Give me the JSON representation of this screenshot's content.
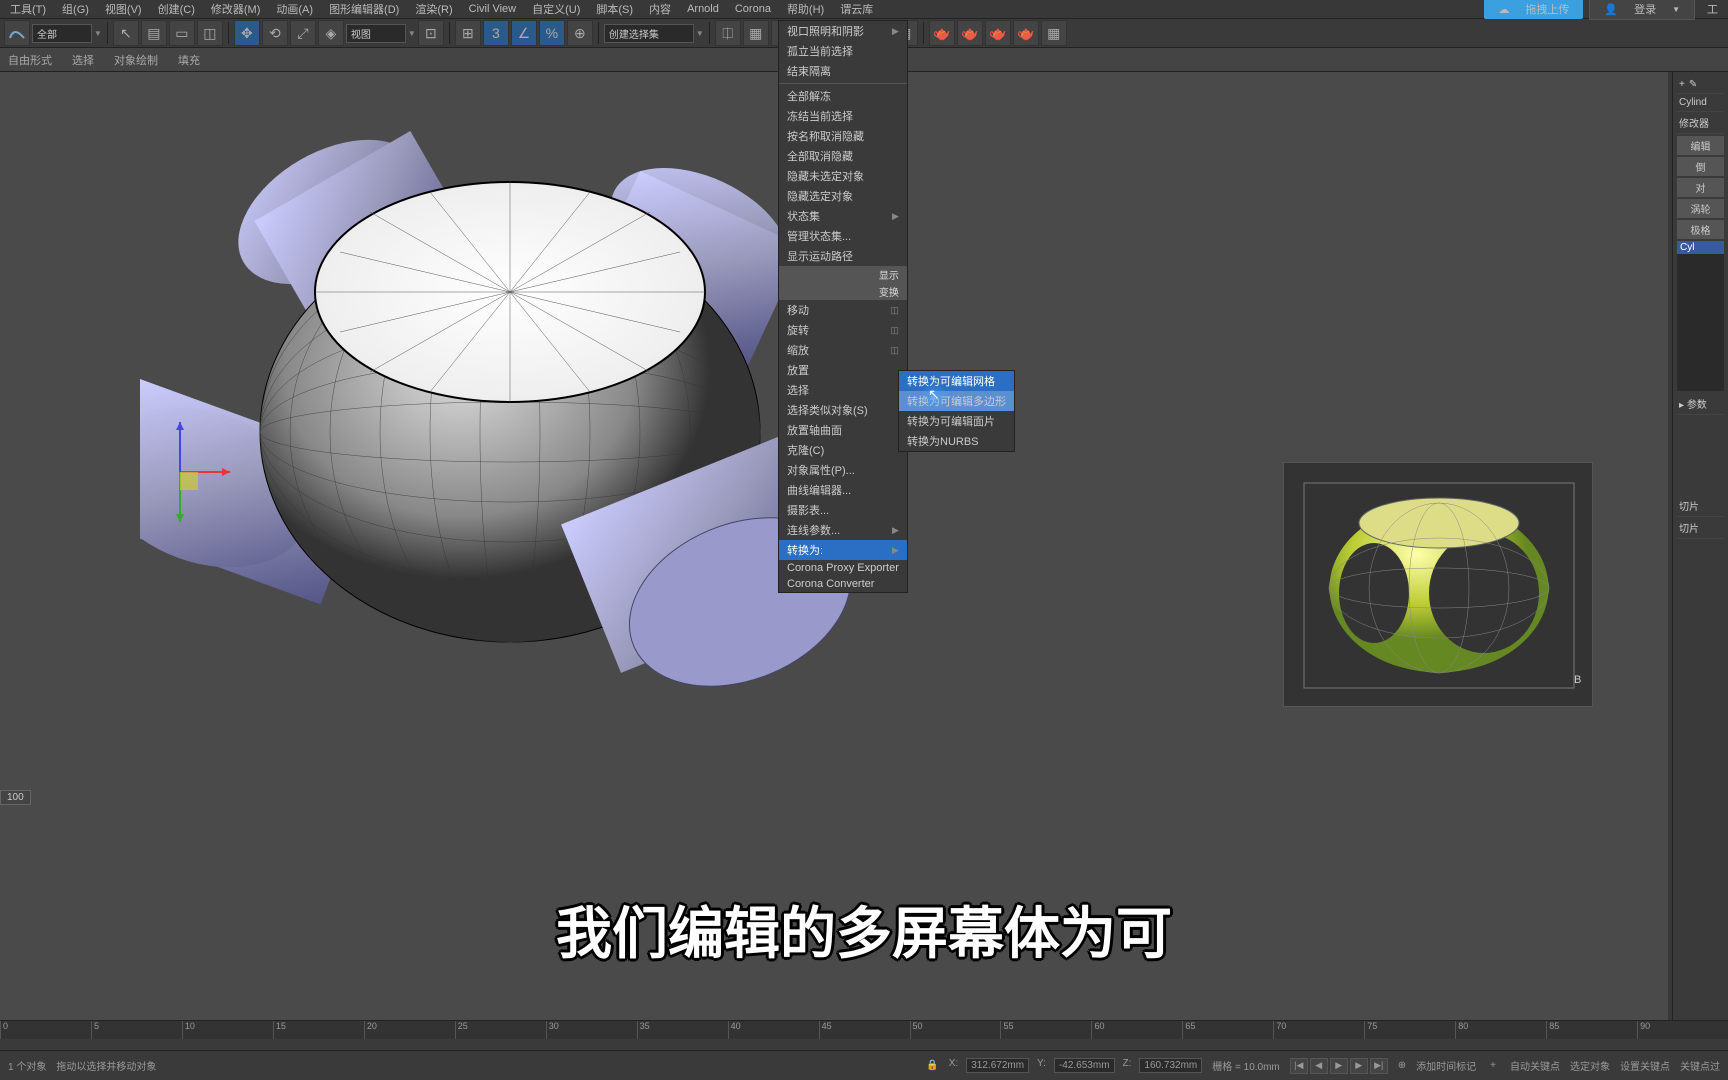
{
  "menubar": {
    "items": [
      "工具(T)",
      "组(G)",
      "视图(V)",
      "创建(C)",
      "修改器(M)",
      "动画(A)",
      "图形编辑器(D)",
      "渲染(R)",
      "Civil View",
      "自定义(U)",
      "脚本(S)",
      "内容",
      "Arnold",
      "Corona",
      "帮助(H)",
      "谓云库"
    ],
    "upload": "拖拽上传",
    "login": "登录",
    "work": "工"
  },
  "toolbar": {
    "all": "全部",
    "view": "视图",
    "seldropdown": "创建选择集"
  },
  "ribbon": {
    "tabs": [
      "自由形式",
      "选择",
      "对象绘制",
      "填充"
    ]
  },
  "context_main": {
    "items": [
      "视口照明和阴影",
      "孤立当前选择",
      "结束隔离",
      "全部解冻",
      "冻结当前选择",
      "按名称取消隐藏",
      "全部取消隐藏",
      "隐藏未选定对象",
      "隐藏选定对象",
      "状态集",
      "管理状态集...",
      "显示运动路径"
    ],
    "hdr1": "显示",
    "hdr2": "变换",
    "items2": [
      "移动",
      "旋转",
      "缩放",
      "放置",
      "选择",
      "选择类似对象(S)",
      "放置轴曲面",
      "克隆(C)",
      "对象属性(P)...",
      "曲线编辑器...",
      "摄影表...",
      "连线参数..."
    ],
    "convert": "转换为:",
    "proxy": "Corona Proxy Exporter",
    "conv": "Corona Converter"
  },
  "context_sub": {
    "items": [
      "转换为可编辑网格",
      "转换为可编辑多边形",
      "转换为可编辑面片",
      "转换为NURBS"
    ]
  },
  "right_panel": {
    "plus": "+",
    "obj_name": "Cylind",
    "mod_label": "修改器",
    "btns": [
      "编辑",
      "倒",
      "对",
      "涡轮",
      "极格"
    ],
    "stack_item": "Cyl",
    "params": "参数",
    "slice1": "切片",
    "slice2": "切片"
  },
  "timeline": {
    "start": "0",
    "ticks": [
      "0",
      "5",
      "10",
      "15",
      "20",
      "25",
      "30",
      "35",
      "40",
      "45",
      "50",
      "55",
      "60",
      "65",
      "70",
      "75",
      "80",
      "85",
      "90"
    ],
    "frame": "100"
  },
  "status": {
    "sel": "1 个对象",
    "hint": "拖动以选择并移动对象",
    "x": "312.672mm",
    "y": "-42.653mm",
    "z": "160.732mm",
    "grid": "栅格 = 10.0mm",
    "addmarker": "添加时间标记",
    "autokey": "自动关键点",
    "selobj": "选定对象",
    "setkey": "设置关键点",
    "keyfilter": "关键点过"
  },
  "subtitle": "我们编辑的多屏幕体为可"
}
